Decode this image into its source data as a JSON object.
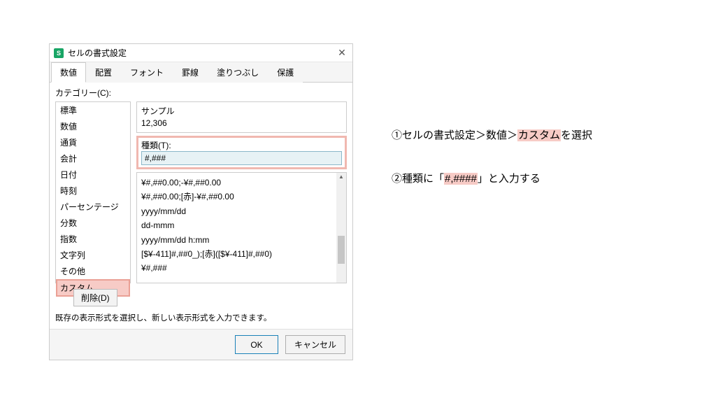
{
  "titlebar": {
    "app_icon": "S",
    "title": "セルの書式設定",
    "close": "✕"
  },
  "tabs": {
    "items": [
      "数値",
      "配置",
      "フォント",
      "罫線",
      "塗りつぶし",
      "保護"
    ],
    "active_index": 0
  },
  "category": {
    "label": "カテゴリー(C):",
    "items": [
      "標準",
      "数値",
      "通貨",
      "会計",
      "日付",
      "時刻",
      "パーセンテージ",
      "分数",
      "指数",
      "文字列",
      "その他",
      "カスタム"
    ],
    "selected_index": 11
  },
  "sample": {
    "label": "サンプル",
    "value": "12,306"
  },
  "type": {
    "label": "種類(T):",
    "value": "#,###"
  },
  "format_list": [
    "¥#,##0.00;-¥#,##0.00",
    "¥#,##0.00;[赤]-¥#,##0.00",
    "yyyy/mm/dd",
    "dd-mmm",
    "yyyy/mm/dd h:mm",
    "[$¥-411]#,##0_);[赤]([$¥-411]#,##0)",
    "¥#,###"
  ],
  "buttons": {
    "delete": "削除(D)",
    "ok": "OK",
    "cancel": "キャンセル"
  },
  "hint": "既存の表示形式を選択し、新しい表示形式を入力できます。",
  "instructions": {
    "step1_pre": "①セルの書式設定＞数値＞",
    "step1_hl": "カスタム",
    "step1_post": "を選択",
    "step2_pre": "②種類に「",
    "step2_hl": "#,####",
    "step2_post": "」と入力する"
  }
}
